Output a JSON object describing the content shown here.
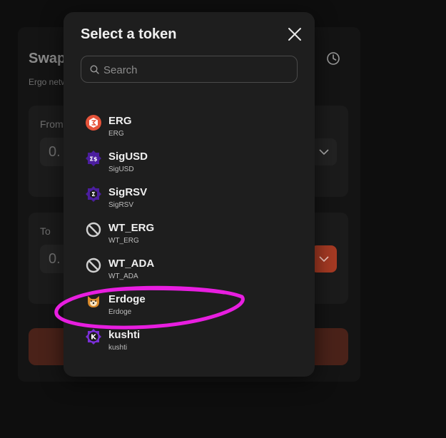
{
  "swap": {
    "title": "Swap",
    "subtitle": "Ergo netw",
    "from_label": "From",
    "from_amount": "0.",
    "to_label": "To",
    "to_amount": "0."
  },
  "modal": {
    "title": "Select a token",
    "search_placeholder": "Search"
  },
  "tokens": [
    {
      "symbol": "ERG",
      "name": "ERG",
      "icon": "erg-icon",
      "color": "#e5533a"
    },
    {
      "symbol": "SigUSD",
      "name": "SigUSD",
      "icon": "sigusd-icon",
      "color": "#4b1e9e"
    },
    {
      "symbol": "SigRSV",
      "name": "SigRSV",
      "icon": "sigrsv-icon",
      "color": "#4b1e9e"
    },
    {
      "symbol": "WT_ERG",
      "name": "WT_ERG",
      "icon": "no-logo-icon",
      "color": "#d0d0d0"
    },
    {
      "symbol": "WT_ADA",
      "name": "WT_ADA",
      "icon": "no-logo-icon",
      "color": "#d0d0d0"
    },
    {
      "symbol": "Erdoge",
      "name": "Erdoge",
      "icon": "erdoge-icon",
      "color": "#d98a2b"
    },
    {
      "symbol": "kushti",
      "name": "kushti",
      "icon": "kushti-icon",
      "color": "#7a2fd6"
    }
  ],
  "colors": {
    "accent": "#e5533a",
    "highlight": "#e81ee0"
  }
}
